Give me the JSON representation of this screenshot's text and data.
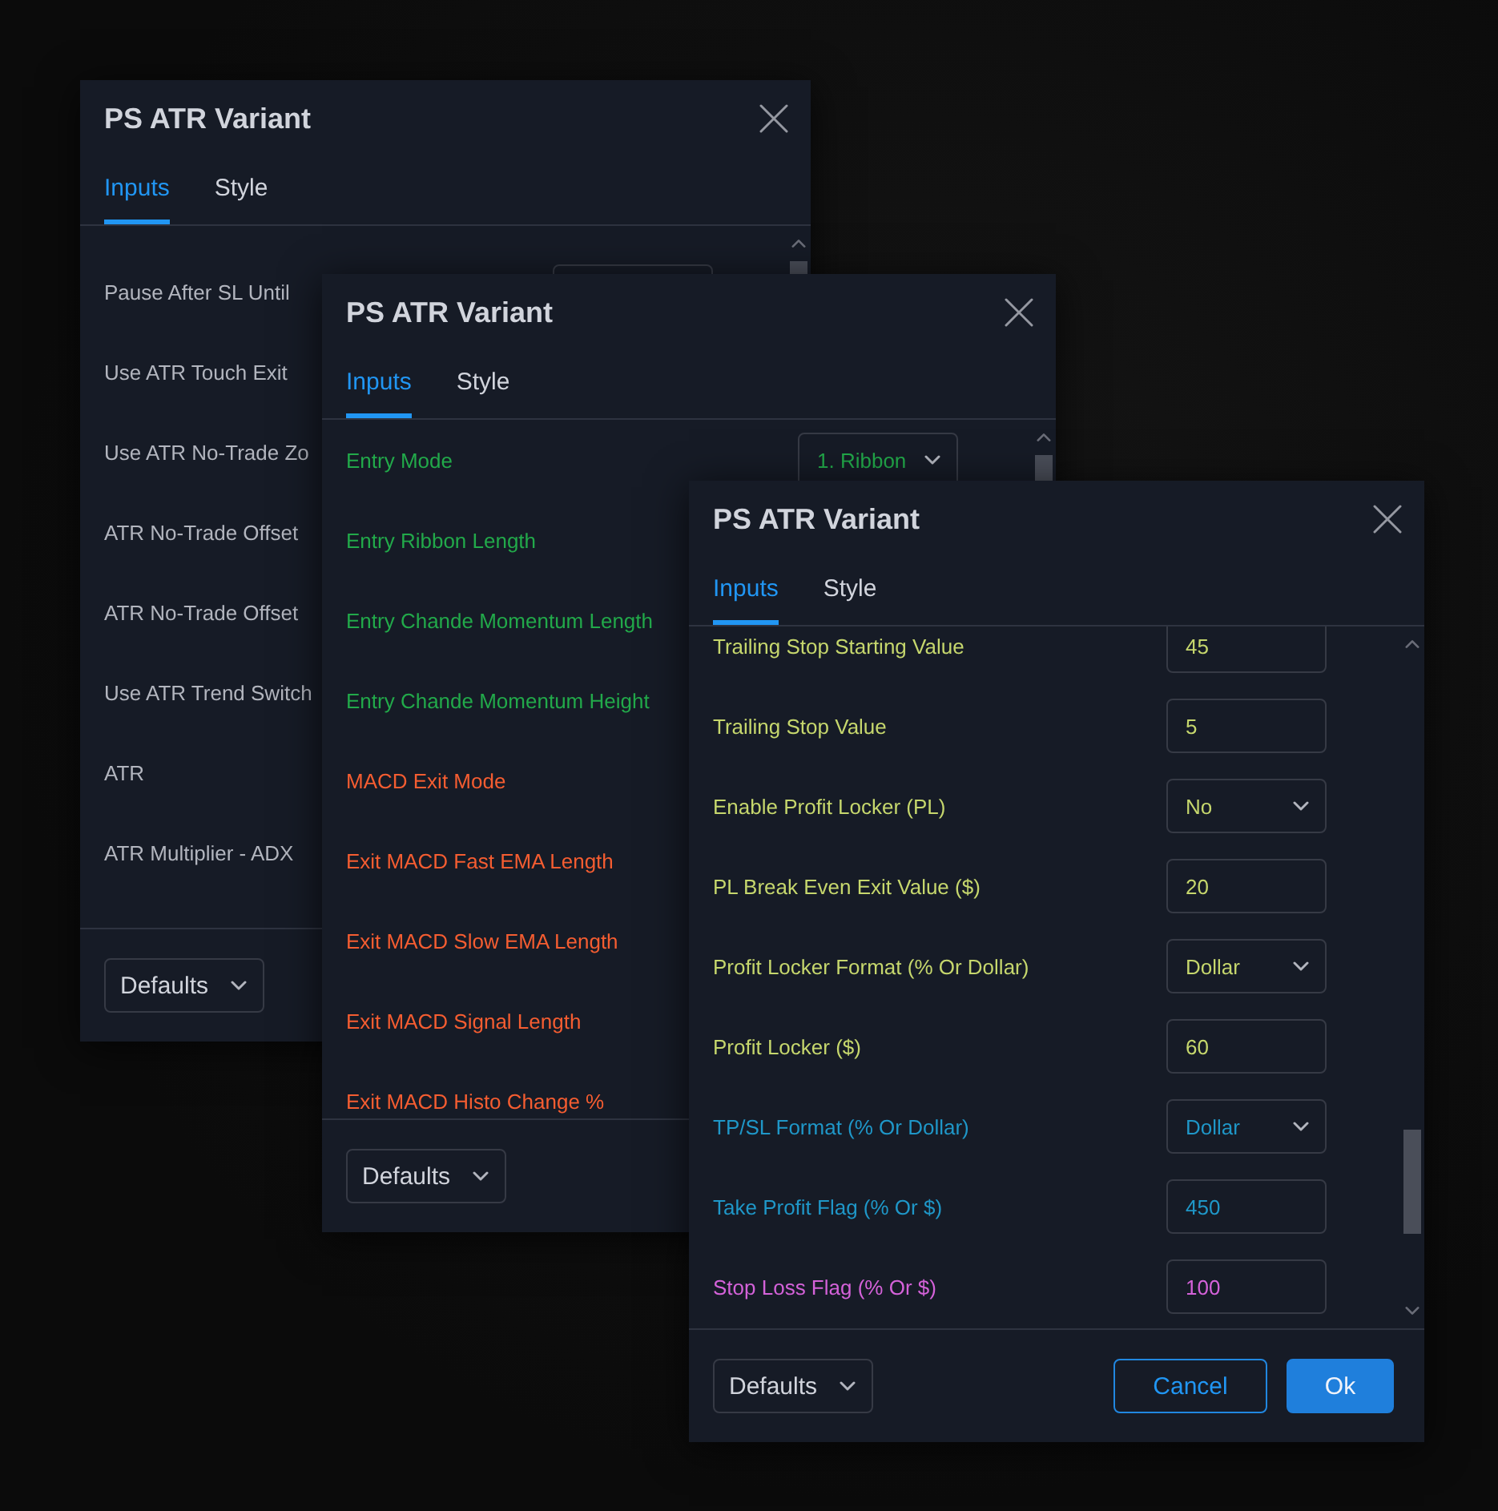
{
  "windows": [
    {
      "title": "PS ATR Variant",
      "tabs": [
        {
          "label": "Inputs",
          "selected": true
        },
        {
          "label": "Style",
          "selected": false
        }
      ],
      "rows": [
        {
          "label": "Pause After SL Until",
          "color": "#b2b5be",
          "kind": "input"
        },
        {
          "label": "Use ATR Touch Exit",
          "color": "#b2b5be",
          "kind": "label"
        },
        {
          "label": "Use ATR No-Trade Zo",
          "color": "#b2b5be",
          "kind": "label"
        },
        {
          "label": "ATR No-Trade Offset",
          "color": "#b2b5be",
          "kind": "label"
        },
        {
          "label": "ATR No-Trade Offset",
          "color": "#b2b5be",
          "kind": "label"
        },
        {
          "label": "Use ATR Trend Switch",
          "color": "#b2b5be",
          "kind": "label"
        },
        {
          "label": "ATR",
          "color": "#b2b5be",
          "kind": "label"
        },
        {
          "label": "ATR Multiplier - ADX",
          "color": "#b2b5be",
          "kind": "label"
        }
      ],
      "footer": {
        "defaults": "Defaults"
      }
    },
    {
      "title": "PS ATR Variant",
      "tabs": [
        {
          "label": "Inputs",
          "selected": true
        },
        {
          "label": "Style",
          "selected": false
        }
      ],
      "rows": [
        {
          "label": "Entry Mode",
          "color": "#22a94a",
          "kind": "select",
          "value": "1. Ribbon"
        },
        {
          "label": "Entry Ribbon Length",
          "color": "#22a94a",
          "kind": "label"
        },
        {
          "label": "Entry Chande Momentum Length",
          "color": "#22a94a",
          "kind": "label"
        },
        {
          "label": "Entry Chande Momentum Height",
          "color": "#22a94a",
          "kind": "label"
        },
        {
          "label": "MACD Exit Mode",
          "color": "#f55d31",
          "kind": "label"
        },
        {
          "label": "Exit MACD Fast EMA Length",
          "color": "#f55d31",
          "kind": "label"
        },
        {
          "label": "Exit MACD Slow EMA Length",
          "color": "#f55d31",
          "kind": "label"
        },
        {
          "label": "Exit MACD Signal Length",
          "color": "#f55d31",
          "kind": "label"
        },
        {
          "label": "Exit MACD Histo Change %",
          "color": "#f55d31",
          "kind": "label"
        }
      ],
      "footer": {
        "defaults": "Defaults"
      }
    },
    {
      "title": "PS ATR Variant",
      "tabs": [
        {
          "label": "Inputs",
          "selected": true
        },
        {
          "label": "Style",
          "selected": false
        }
      ],
      "rows": [
        {
          "label": "Trailing Stop Starting Value",
          "color": "#c6d76d",
          "kind": "input",
          "value": "45"
        },
        {
          "label": "Trailing Stop Value",
          "color": "#c6d76d",
          "kind": "input",
          "value": "5"
        },
        {
          "label": "Enable Profit Locker (PL)",
          "color": "#c6d76d",
          "kind": "select",
          "value": "No"
        },
        {
          "label": "PL Break Even Exit Value ($)",
          "color": "#c6d76d",
          "kind": "input",
          "value": "20"
        },
        {
          "label": "Profit Locker Format (% Or Dollar)",
          "color": "#c6d76d",
          "kind": "select",
          "value": "Dollar"
        },
        {
          "label": "Profit Locker ($)",
          "color": "#c6d76d",
          "kind": "input",
          "value": "60"
        },
        {
          "label": "TP/SL Format (% Or Dollar)",
          "color": "#1f97c8",
          "kind": "select",
          "value": "Dollar"
        },
        {
          "label": "Take Profit Flag (% Or $)",
          "color": "#1f97c8",
          "kind": "input",
          "value": "450"
        },
        {
          "label": "Stop Loss Flag (% Or $)",
          "color": "#d462d9",
          "kind": "input",
          "value": "100"
        }
      ],
      "footer": {
        "defaults": "Defaults",
        "buttons": [
          {
            "label": "Cancel",
            "kind": "secondary"
          },
          {
            "label": "Ok",
            "kind": "primary"
          }
        ]
      }
    }
  ]
}
